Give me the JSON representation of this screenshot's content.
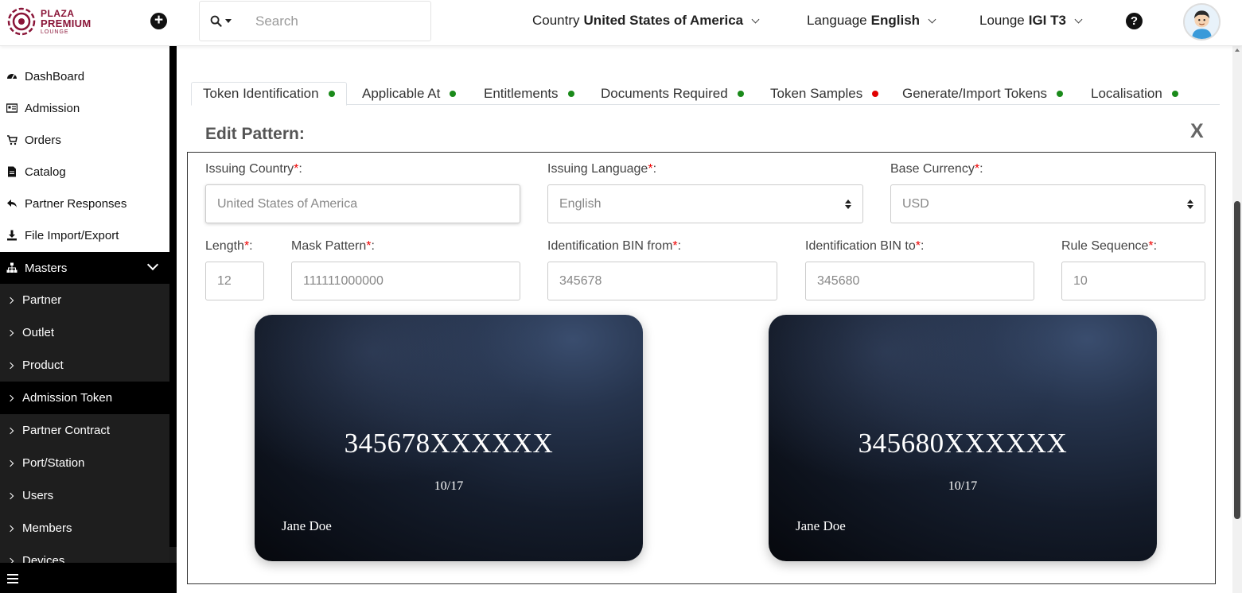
{
  "brand": {
    "line1": "PLAZA",
    "line2": "PREMIUM",
    "line3": "LOUNGE"
  },
  "header": {
    "search_placeholder": "Search",
    "country_label": "Country",
    "country_value": "United States of America",
    "language_label": "Language",
    "language_value": "English",
    "lounge_label": "Lounge",
    "lounge_value": "IGI T3",
    "help_glyph": "?"
  },
  "sidebar": {
    "items": [
      {
        "label": "DashBoard",
        "icon": "dashboard-icon"
      },
      {
        "label": "Admission",
        "icon": "id-card-icon"
      },
      {
        "label": "Orders",
        "icon": "cart-icon"
      },
      {
        "label": "Catalog",
        "icon": "document-icon"
      },
      {
        "label": "Partner Responses",
        "icon": "reply-icon"
      },
      {
        "label": "File Import/Export",
        "icon": "download-icon"
      },
      {
        "label": "Masters",
        "icon": "sitemap-icon"
      }
    ],
    "sub_items": [
      {
        "label": "Partner"
      },
      {
        "label": "Outlet"
      },
      {
        "label": "Product"
      },
      {
        "label": "Admission Token"
      },
      {
        "label": "Partner Contract"
      },
      {
        "label": "Port/Station"
      },
      {
        "label": "Users"
      },
      {
        "label": "Members"
      },
      {
        "label": "Devices"
      }
    ]
  },
  "tabs": [
    {
      "label": "Token Identification",
      "status_color": "#1a8a1a"
    },
    {
      "label": "Applicable At",
      "status_color": "#1a8a1a"
    },
    {
      "label": "Entitlements",
      "status_color": "#1a8a1a"
    },
    {
      "label": "Documents Required",
      "status_color": "#1a8a1a"
    },
    {
      "label": "Token Samples",
      "status_color": "#e00000"
    },
    {
      "label": "Generate/Import Tokens",
      "status_color": "#1a8a1a"
    },
    {
      "label": "Localisation",
      "status_color": "#1a8a1a"
    }
  ],
  "form": {
    "title": "Edit Pattern:",
    "close": "X",
    "required_mark": "*",
    "fields": {
      "issuing_country": {
        "label": "Issuing Country",
        "value": "United States of America"
      },
      "issuing_language": {
        "label": "Issuing Language",
        "value": "English"
      },
      "base_currency": {
        "label": "Base Currency",
        "value": "USD"
      },
      "length": {
        "label": "Length",
        "value": "12"
      },
      "mask_pattern": {
        "label": "Mask Pattern",
        "value": "111111000000"
      },
      "bin_from": {
        "label": "Identification BIN from",
        "value": "345678"
      },
      "bin_to": {
        "label": "Identification BIN to",
        "value": "345680"
      },
      "rule_sequence": {
        "label": "Rule Sequence",
        "value": "10"
      }
    }
  },
  "cards": [
    {
      "number": "345678XXXXXX",
      "expiry": "10/17",
      "holder": "Jane Doe"
    },
    {
      "number": "345680XXXXXX",
      "expiry": "10/17",
      "holder": "Jane Doe"
    }
  ]
}
